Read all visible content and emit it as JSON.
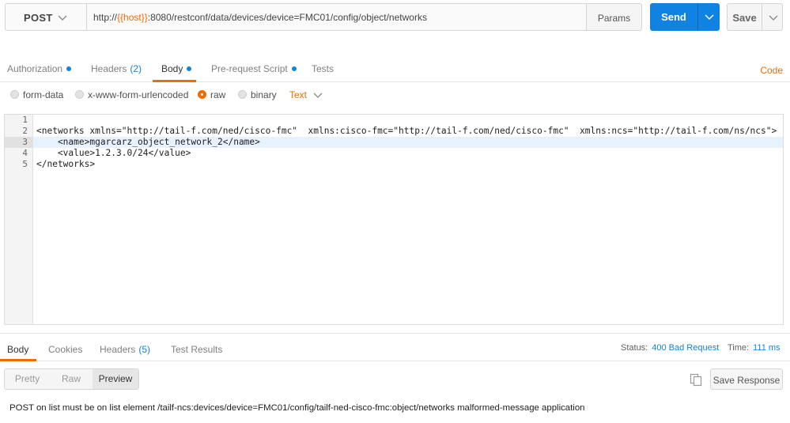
{
  "request": {
    "method": "POST",
    "url_prefix": "http://",
    "url_variable": "{{host}}",
    "url_suffix": ":8080/restconf/data/devices/device=FMC01/config/object/networks",
    "params_label": "Params",
    "send_label": "Send",
    "save_label": "Save"
  },
  "req_tabs": {
    "authorization": "Authorization",
    "headers": "Headers",
    "headers_count": "(2)",
    "body": "Body",
    "prerequest": "Pre-request Script",
    "tests": "Tests",
    "code": "Code",
    "active_tab": "Body"
  },
  "body_types": {
    "form_data": "form-data",
    "urlencoded": "x-www-form-urlencoded",
    "raw": "raw",
    "binary": "binary",
    "selected": "raw",
    "content_type": "Text"
  },
  "editor": {
    "line_numbers": [
      "1",
      "2",
      "3",
      "4",
      "5"
    ],
    "lines": [
      "",
      "<networks xmlns=\"http://tail-f.com/ned/cisco-fmc\"  xmlns:cisco-fmc=\"http://tail-f.com/ned/cisco-fmc\"  xmlns:ncs=\"http://tail-f.com/ns/ncs\">",
      "    <name>mgarcarz_object_network_2</name>",
      "    <value>1.2.3.0/24</value>",
      "</networks>"
    ],
    "active_line": "3"
  },
  "response": {
    "tabs": {
      "body": "Body",
      "cookies": "Cookies",
      "headers": "Headers",
      "headers_count": "(5)",
      "test_results": "Test Results"
    },
    "status_label": "Status:",
    "status_value": "400 Bad Request",
    "time_label": "Time:",
    "time_value": "111 ms",
    "views": {
      "pretty": "Pretty",
      "raw": "Raw",
      "preview": "Preview",
      "active": "Preview"
    },
    "save_response_label": "Save Response",
    "body_text": "POST on list must be on list element /tailf-ncs:devices/device=FMC01/config/tailf-ned-cisco-fmc:object/networks malformed-message application"
  },
  "colors": {
    "accent_orange": "#ef6c00",
    "primary_blue": "#1082e2",
    "line_highlight": "#e8f2fe"
  }
}
